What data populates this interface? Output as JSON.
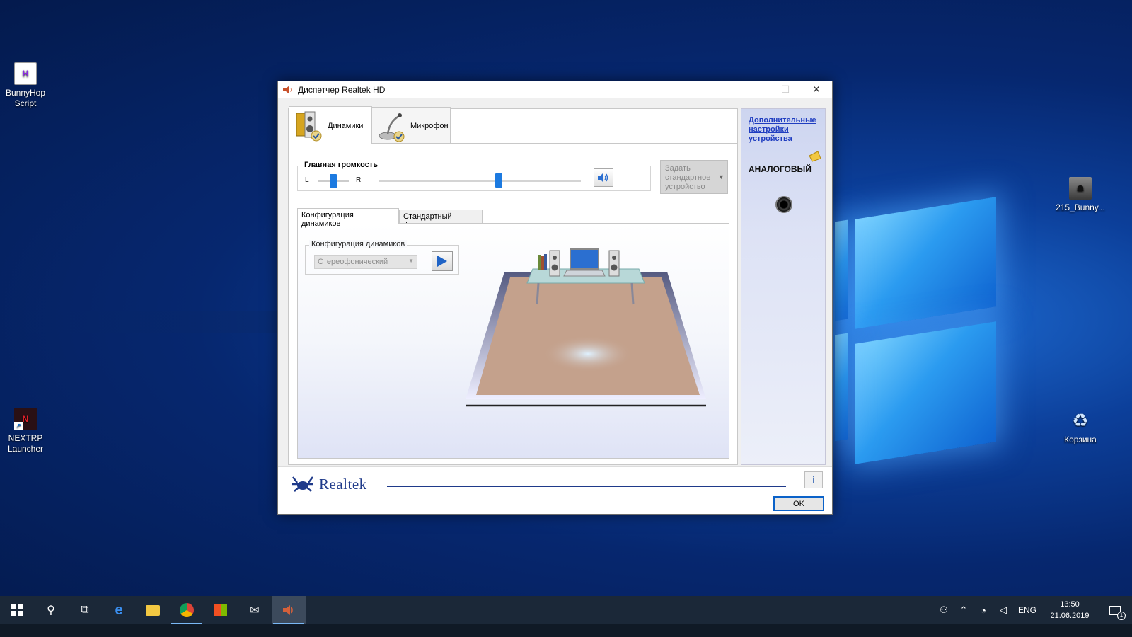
{
  "desktop": {
    "icons": [
      {
        "label": "BunnyHop Script"
      },
      {
        "label": "NEXTRP Launcher"
      },
      {
        "label": "215_Bunny..."
      },
      {
        "label": "Корзина"
      }
    ]
  },
  "window": {
    "title": "Диспетчер Realtek HD",
    "device_tabs": [
      {
        "label": "Динамики",
        "active": true
      },
      {
        "label": "Микрофон",
        "active": false
      }
    ],
    "volume": {
      "title": "Главная громкость",
      "left_label": "L",
      "right_label": "R",
      "balance": 0.5,
      "level": 0.59
    },
    "set_default_label": "Задать стандартное устройство",
    "sub_tabs": [
      {
        "label": "Конфигурация динамиков",
        "active": true
      },
      {
        "label": "Стандартный формат",
        "active": false
      }
    ],
    "speaker_config": {
      "group_label": "Конфигурация динамиков",
      "selected": "Стереофонический"
    },
    "side": {
      "advanced_link": "Дополнительные настройки устройства",
      "analog_label": "АНАЛОГОВЫЙ"
    },
    "footer": {
      "brand": "Realtek",
      "info_label": "i",
      "ok_label": "OK"
    }
  },
  "taskbar": {
    "tray": {
      "language": "ENG",
      "time": "13:50",
      "date": "21.06.2019",
      "notification_count": "1"
    }
  },
  "colors": {
    "accent": "#0b62c9",
    "link": "#1f3dc0",
    "brand": "#1f3a8a",
    "taskbar": "#1b2838"
  }
}
